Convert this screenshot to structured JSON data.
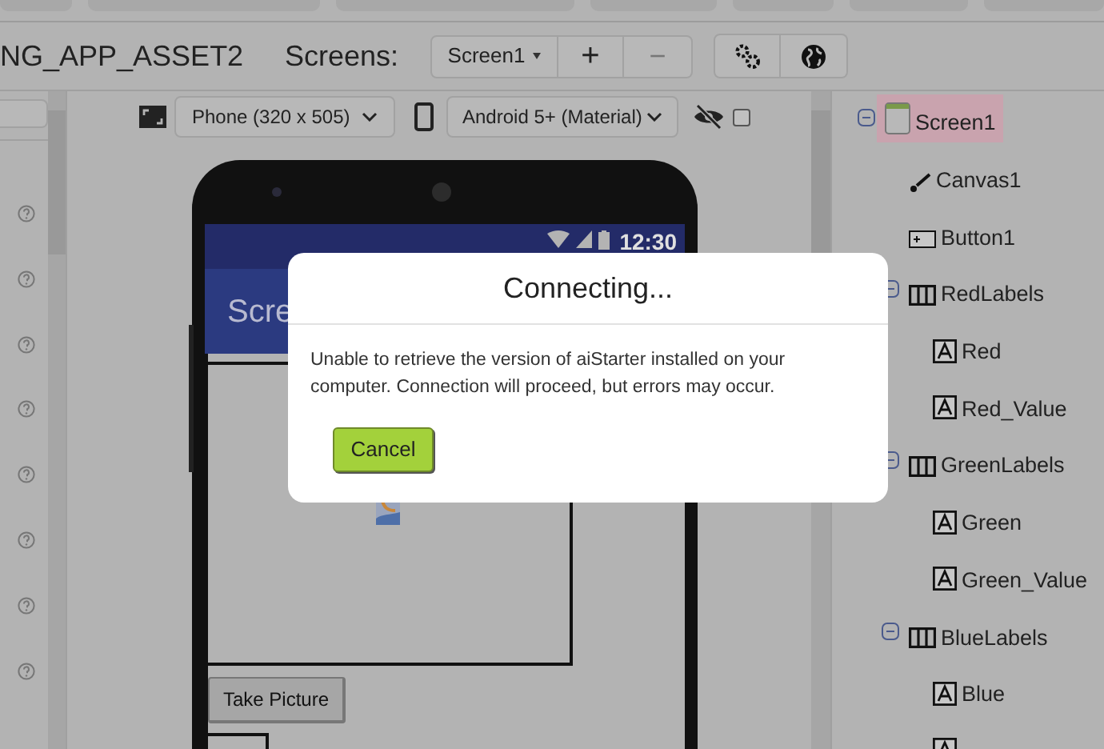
{
  "header": {
    "project_title": "NG_APP_ASSET2",
    "screens_label": "Screens:",
    "screen_select": "Screen1",
    "add_button": "+",
    "remove_button": "−"
  },
  "viewer": {
    "size_select": "Phone (320 x 505)",
    "theme_select": "Android 5+ (Material)",
    "show_hidden_checked": false
  },
  "phone": {
    "time": "12:30",
    "title": "Scre",
    "button": "Take Picture"
  },
  "tree": [
    {
      "name": "Screen1",
      "kind": "screen",
      "selected": true,
      "expanded": true,
      "children": [
        {
          "name": "Canvas1",
          "kind": "canvas",
          "selected": false
        },
        {
          "name": "Button1",
          "kind": "button",
          "selected": false
        },
        {
          "name": "RedLabels",
          "kind": "arrangement",
          "selected": false,
          "expanded": true,
          "children": [
            {
              "name": "Red",
              "kind": "label",
              "selected": false
            },
            {
              "name": "Red_Value",
              "kind": "label",
              "selected": false
            }
          ]
        },
        {
          "name": "GreenLabels",
          "kind": "arrangement",
          "selected": false,
          "expanded": true,
          "children": [
            {
              "name": "Green",
              "kind": "label",
              "selected": false
            },
            {
              "name": "Green_Value",
              "kind": "label",
              "selected": false
            }
          ]
        },
        {
          "name": "BlueLabels",
          "kind": "arrangement",
          "selected": false,
          "expanded": true,
          "children": [
            {
              "name": "Blue",
              "kind": "label",
              "selected": false
            },
            {
              "kind": "label",
              "selected": false
            }
          ]
        }
      ]
    }
  ],
  "dialog": {
    "title": "Connecting...",
    "message": "Unable to retrieve the version of aiStarter installed on your computer. Connection will proceed, but errors may occur.",
    "cancel": "Cancel"
  }
}
